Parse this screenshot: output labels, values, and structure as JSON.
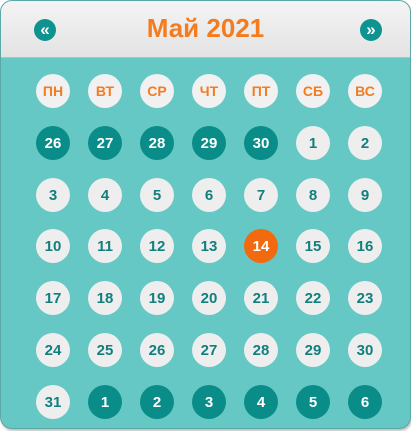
{
  "header": {
    "title": "Май 2021",
    "prev_icon": "«",
    "next_icon": "»"
  },
  "weekdays": [
    "ПН",
    "ВТ",
    "СР",
    "ЧТ",
    "ПТ",
    "СБ",
    "ВС"
  ],
  "weeks": [
    [
      {
        "label": "26",
        "state": "other"
      },
      {
        "label": "27",
        "state": "other"
      },
      {
        "label": "28",
        "state": "other"
      },
      {
        "label": "29",
        "state": "other"
      },
      {
        "label": "30",
        "state": "other"
      },
      {
        "label": "1",
        "state": "current"
      },
      {
        "label": "2",
        "state": "current"
      }
    ],
    [
      {
        "label": "3",
        "state": "current"
      },
      {
        "label": "4",
        "state": "current"
      },
      {
        "label": "5",
        "state": "current"
      },
      {
        "label": "6",
        "state": "current"
      },
      {
        "label": "7",
        "state": "current"
      },
      {
        "label": "8",
        "state": "current"
      },
      {
        "label": "9",
        "state": "current"
      }
    ],
    [
      {
        "label": "10",
        "state": "current"
      },
      {
        "label": "11",
        "state": "current"
      },
      {
        "label": "12",
        "state": "current"
      },
      {
        "label": "13",
        "state": "current"
      },
      {
        "label": "14",
        "state": "today"
      },
      {
        "label": "15",
        "state": "current"
      },
      {
        "label": "16",
        "state": "current"
      }
    ],
    [
      {
        "label": "17",
        "state": "current"
      },
      {
        "label": "18",
        "state": "current"
      },
      {
        "label": "19",
        "state": "current"
      },
      {
        "label": "20",
        "state": "current"
      },
      {
        "label": "21",
        "state": "current"
      },
      {
        "label": "22",
        "state": "current"
      },
      {
        "label": "23",
        "state": "current"
      }
    ],
    [
      {
        "label": "24",
        "state": "current"
      },
      {
        "label": "25",
        "state": "current"
      },
      {
        "label": "26",
        "state": "current"
      },
      {
        "label": "27",
        "state": "current"
      },
      {
        "label": "28",
        "state": "current"
      },
      {
        "label": "29",
        "state": "current"
      },
      {
        "label": "30",
        "state": "current"
      }
    ],
    [
      {
        "label": "31",
        "state": "current"
      },
      {
        "label": "1",
        "state": "other"
      },
      {
        "label": "2",
        "state": "other"
      },
      {
        "label": "3",
        "state": "other"
      },
      {
        "label": "4",
        "state": "other"
      },
      {
        "label": "5",
        "state": "other"
      },
      {
        "label": "6",
        "state": "other"
      }
    ]
  ],
  "colors": {
    "background": "#65c8c5",
    "accent": "#f47c1f",
    "today": "#f26a0f",
    "other_month": "#0a8c89",
    "day_text": "#117f7d"
  }
}
